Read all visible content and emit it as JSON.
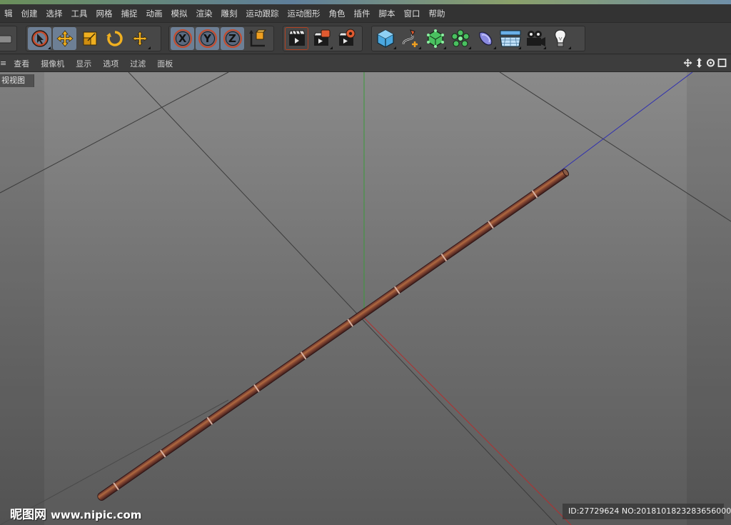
{
  "menu": [
    "辑",
    "创建",
    "选择",
    "工具",
    "网格",
    "捕捉",
    "动画",
    "模拟",
    "渲染",
    "雕刻",
    "运动跟踪",
    "运动图形",
    "角色",
    "插件",
    "脚本",
    "窗口",
    "帮助"
  ],
  "toolbar": {
    "mode_tools": [
      "select-icon",
      "move-icon",
      "scale-icon",
      "rotate-icon",
      "recent-tool-icon"
    ],
    "axis_labels": [
      "X",
      "Y",
      "Z"
    ],
    "render_tools": [
      "render-view-icon",
      "render-picture-viewer-icon",
      "render-settings-icon"
    ],
    "object_tools": [
      "cube-icon",
      "spline-pen-icon",
      "subdivision-surface-icon",
      "cloner-icon",
      "deformer-icon",
      "floor-icon",
      "camera-icon",
      "light-icon"
    ],
    "active_color": "#6d7f95"
  },
  "viewbar": {
    "items": [
      "查看",
      "摄像机",
      "显示",
      "选项",
      "过滤",
      "面板"
    ],
    "nav_icons": [
      "pan-icon",
      "dolly-icon",
      "orbit-icon",
      "maximize-icon"
    ]
  },
  "viewport": {
    "label": "视视图",
    "axis_colors": {
      "x": "#b03030",
      "y": "#3a9a3a",
      "z": "#3030b0"
    }
  },
  "watermark": {
    "brand": "昵图网",
    "site": "www.nipic.com",
    "id_text": "ID:27729624 NO:20181018232836560000"
  }
}
